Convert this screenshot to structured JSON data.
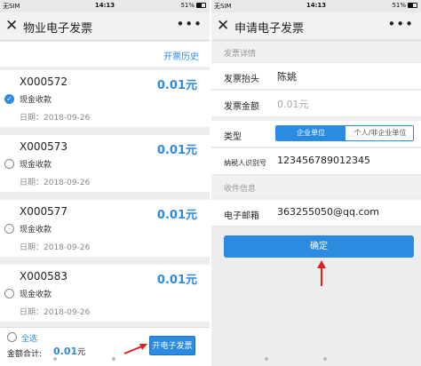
{
  "status_bar": {
    "carrier": "无SIM",
    "time": "14:13",
    "battery": "51%"
  },
  "left": {
    "title": "物业电子发票",
    "history_link": "开票历史",
    "invoices": [
      {
        "code": "X000572",
        "amount": "0.01元",
        "method": "现金收款",
        "date": "日期：2018-09-26",
        "selected": true
      },
      {
        "code": "X000573",
        "amount": "0.01元",
        "method": "现金收款",
        "date": "日期：2018-09-26",
        "selected": false
      },
      {
        "code": "X000577",
        "amount": "0.01元",
        "method": "现金收款",
        "date": "日期：2018-09-26",
        "selected": false
      },
      {
        "code": "X000583",
        "amount": "0.01元",
        "method": "现金收款",
        "date": "日期：2018-09-26",
        "selected": false
      }
    ],
    "select_all": "全选",
    "total_label": "金额合计:",
    "total_value": "0.01",
    "total_unit": "元",
    "issue_button": "开电子发票"
  },
  "right": {
    "title": "申请电子发票",
    "section_details": "发票详情",
    "header_label": "发票抬头",
    "header_value": "陈姚",
    "amount_label": "发票金额",
    "amount_value": "0.01元",
    "type_label": "类型",
    "type_options": [
      "企业单位",
      "个人/非企业单位"
    ],
    "tax_id_label": "纳税人识别号",
    "tax_id_value": "123456789012345",
    "section_recipient": "收件信息",
    "email_label": "电子邮箱",
    "email_value": "363255050@qq.com",
    "confirm_button": "确定"
  },
  "colors": {
    "accent": "#2a8be0",
    "arrow": "#e02020"
  }
}
